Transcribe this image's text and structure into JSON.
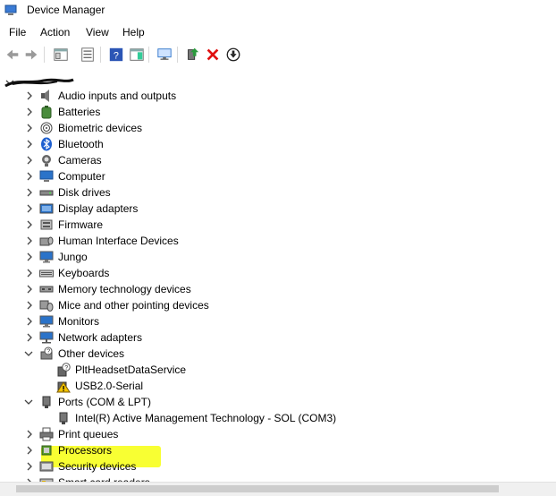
{
  "window": {
    "title": "Device Manager"
  },
  "menu": [
    "File",
    "Action",
    "View",
    "Help"
  ],
  "toolbar": [
    {
      "name": "back-icon",
      "sym": "back"
    },
    {
      "name": "forward-icon",
      "sym": "fwd"
    },
    {
      "name": "properties-icon",
      "sym": "props"
    },
    {
      "name": "show-hide-icon",
      "sym": "list"
    },
    {
      "name": "help-icon",
      "sym": "help"
    },
    {
      "name": "action-pane-icon",
      "sym": "pane"
    },
    {
      "name": "scan-hardware-icon",
      "sym": "monitor"
    },
    {
      "name": "update-driver-icon",
      "sym": "update"
    },
    {
      "name": "uninstall-device-icon",
      "sym": "x"
    },
    {
      "name": "disable-device-icon",
      "sym": "down"
    }
  ],
  "tree": [
    {
      "label": "Audio inputs and outputs",
      "icon": "speaker-icon",
      "level": 1,
      "expanded": false
    },
    {
      "label": "Batteries",
      "icon": "battery-icon",
      "level": 1,
      "expanded": false
    },
    {
      "label": "Biometric devices",
      "icon": "fingerprint-icon",
      "level": 1,
      "expanded": false
    },
    {
      "label": "Bluetooth",
      "icon": "bluetooth-icon",
      "level": 1,
      "expanded": false
    },
    {
      "label": "Cameras",
      "icon": "camera-icon",
      "level": 1,
      "expanded": false
    },
    {
      "label": "Computer",
      "icon": "computer-icon",
      "level": 1,
      "expanded": false
    },
    {
      "label": "Disk drives",
      "icon": "disk-icon",
      "level": 1,
      "expanded": false
    },
    {
      "label": "Display adapters",
      "icon": "display-adapter-icon",
      "level": 1,
      "expanded": false
    },
    {
      "label": "Firmware",
      "icon": "firmware-icon",
      "level": 1,
      "expanded": false
    },
    {
      "label": "Human Interface Devices",
      "icon": "hid-icon",
      "level": 1,
      "expanded": false
    },
    {
      "label": "Jungo",
      "icon": "monitor-icon",
      "level": 1,
      "expanded": false
    },
    {
      "label": "Keyboards",
      "icon": "keyboard-icon",
      "level": 1,
      "expanded": false
    },
    {
      "label": "Memory technology devices",
      "icon": "memory-icon",
      "level": 1,
      "expanded": false
    },
    {
      "label": "Mice and other pointing devices",
      "icon": "mouse-icon",
      "level": 1,
      "expanded": false
    },
    {
      "label": "Monitors",
      "icon": "monitor-icon",
      "level": 1,
      "expanded": false
    },
    {
      "label": "Network adapters",
      "icon": "network-icon",
      "level": 1,
      "expanded": false
    },
    {
      "label": "Other devices",
      "icon": "other-devices-icon",
      "level": 1,
      "expanded": true
    },
    {
      "label": "PltHeadsetDataService",
      "icon": "unknown-device-icon",
      "level": 2
    },
    {
      "label": "USB2.0-Serial",
      "icon": "warning-device-icon",
      "level": 2
    },
    {
      "label": "Ports (COM & LPT)",
      "icon": "port-icon",
      "level": 1,
      "expanded": true
    },
    {
      "label": "Intel(R) Active Management Technology - SOL (COM3)",
      "icon": "port-icon",
      "level": 2
    },
    {
      "label": "Print queues",
      "icon": "printer-icon",
      "level": 1,
      "expanded": false
    },
    {
      "label": "Processors",
      "icon": "processor-icon",
      "level": 1,
      "expanded": false
    },
    {
      "label": "Security devices",
      "icon": "security-icon",
      "level": 1,
      "expanded": false
    },
    {
      "label": "Smart card readers",
      "icon": "smartcard-icon",
      "level": 1,
      "expanded": false
    }
  ],
  "colors": {
    "highlight": "#f8ff33",
    "accent_blue": "#2b73c9",
    "warning": "#f2c200"
  }
}
